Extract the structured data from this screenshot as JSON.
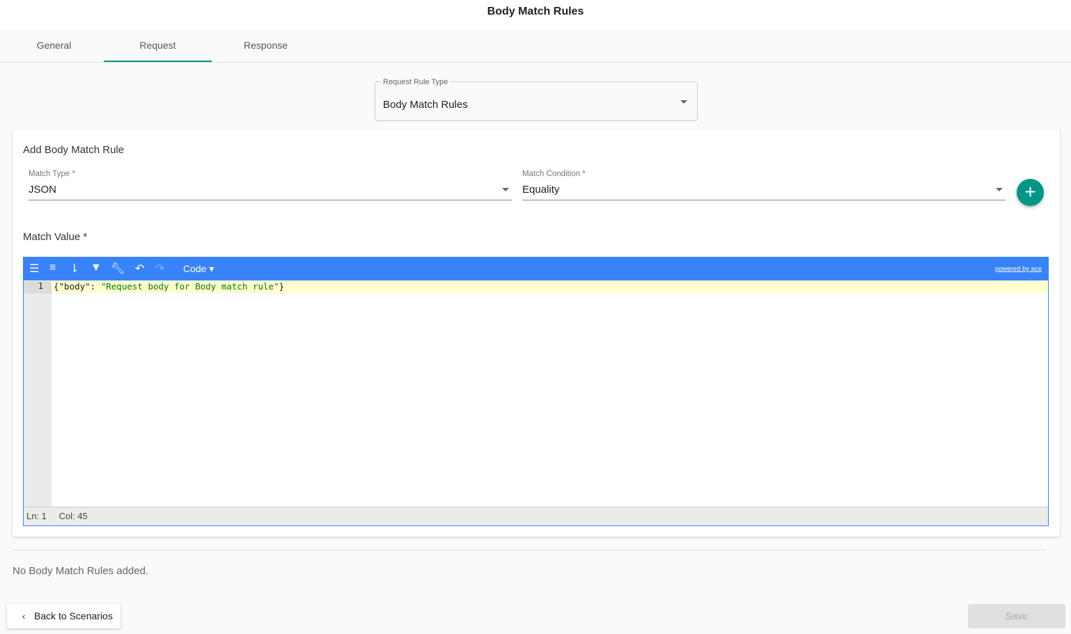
{
  "title": "Body Match Rules",
  "tabs": [
    {
      "label": "General"
    },
    {
      "label": "Request"
    },
    {
      "label": "Response"
    }
  ],
  "request_rule_type": {
    "label": "Request Rule Type",
    "value": "Body Match Rules"
  },
  "card": {
    "heading": "Add Body Match Rule",
    "match_type": {
      "label": "Match Type *",
      "value": "JSON"
    },
    "match_condition": {
      "label": "Match Condition *",
      "value": "Equality"
    },
    "add_icon": "+",
    "match_value_label": "Match Value *",
    "editor": {
      "mode_label": "Code ▾",
      "powered": "powered by ace",
      "line_number": "1",
      "code_key": "{\"body\": ",
      "code_string": "\"Request body for Body match rule\"",
      "code_end": "}",
      "status_ln": "Ln: 1",
      "status_col": "Col: 45"
    }
  },
  "empty_message": "No Body Match Rules added.",
  "back_button": "Back to Scenarios",
  "save_button": "Save",
  "colors": {
    "accent": "#009688",
    "editor": "#3883fa"
  }
}
